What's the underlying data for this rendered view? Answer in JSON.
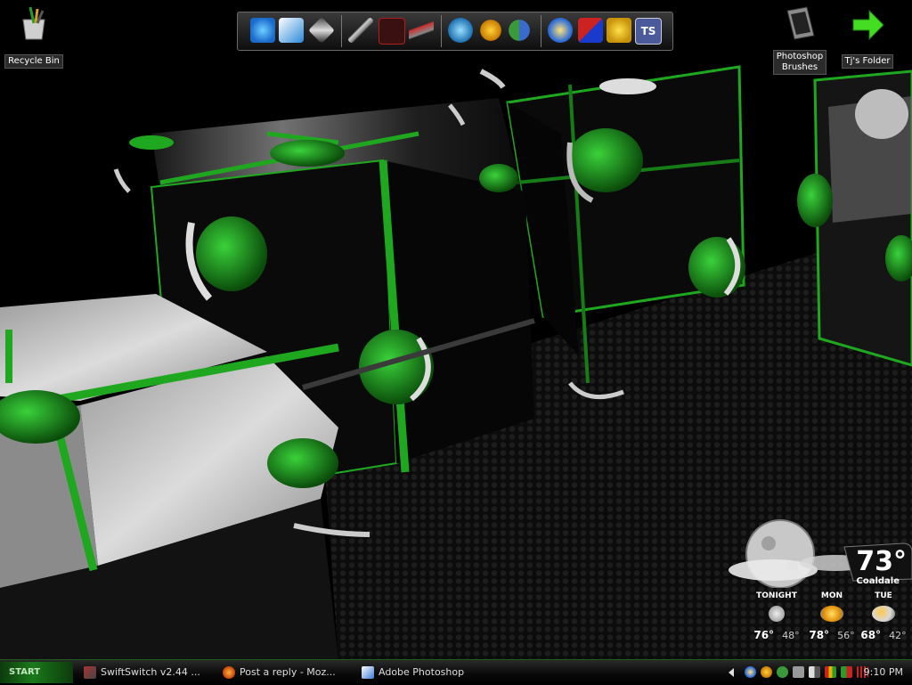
{
  "desktop": {
    "icons": [
      {
        "label": "Recycle Bin",
        "icon": "recycle-bin-icon"
      },
      {
        "label": "Photoshop Brushes",
        "label_lines": [
          "Photoshop",
          "Brushes"
        ],
        "icon": "document-icon"
      },
      {
        "label": "Tj's Folder",
        "icon": "green-arrow-folder-icon"
      }
    ]
  },
  "dock": {
    "icons": [
      "internet-explorer-icon",
      "feather-app-icon",
      "rocket-dock-icon",
      "sword-icon",
      "cross-x-icon",
      "jet-icon",
      "link-rings-icon",
      "aim-icon",
      "messenger-icon",
      "avant-browser-icon",
      "media-monkey-icon",
      "keys-icon",
      "teamspeak-icon"
    ],
    "teamspeak_label": "TS"
  },
  "weather": {
    "temp": "73°",
    "city": "Coaldale",
    "forecast": [
      {
        "day": "TONIGHT",
        "high": "76°",
        "low": "48°",
        "icon": "moon-icon"
      },
      {
        "day": "MON",
        "high": "78°",
        "low": "56°",
        "icon": "sun-icon"
      },
      {
        "day": "TUE",
        "high": "68°",
        "low": "42°",
        "icon": "partly-cloudy-icon"
      }
    ]
  },
  "taskbar": {
    "start_label": "START",
    "tasks": [
      {
        "label": "SwiftSwitch v2.44 ...",
        "icon": "swiftswitch-icon"
      },
      {
        "label": "Post a reply - Moz...",
        "icon": "firefox-icon"
      },
      {
        "label": "Adobe Photoshop",
        "icon": "photoshop-icon"
      }
    ],
    "tray_icons": [
      "tray-arrow-icon",
      "tray-avant-icon",
      "tray-aim-icon",
      "tray-messenger-icon",
      "tray-monitor-icon",
      "tray-volume-icon",
      "tray-grid-icon",
      "tray-flag-icon",
      "tray-bars-icon"
    ],
    "clock": "9:10 PM"
  },
  "colors": {
    "accent_green": "#1fa81f",
    "dark": "#000000"
  }
}
